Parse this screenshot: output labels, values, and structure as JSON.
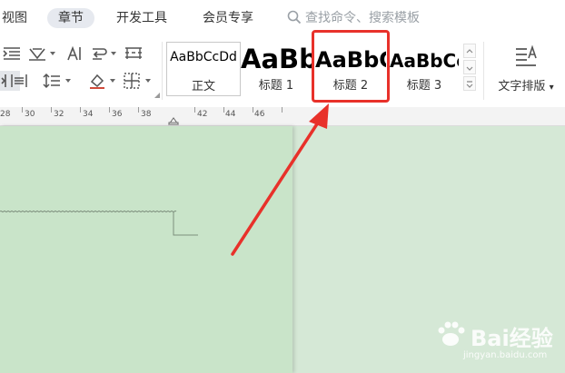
{
  "menubar": {
    "items": [
      "视图",
      "章节",
      "开发工具",
      "会员专享"
    ],
    "active": "章节",
    "search_placeholder": "查找命令、搜索模板"
  },
  "styles_gallery": {
    "cards": [
      {
        "sample": "AaBbCcDd",
        "name": "正文"
      },
      {
        "sample": "AaBb",
        "name": "标题 1"
      },
      {
        "sample": "AaBbC",
        "name": "标题 2"
      },
      {
        "sample": "AaBbCc",
        "name": "标题 3"
      }
    ],
    "highlighted": "标题 2"
  },
  "text_layout": {
    "label": "文字排版"
  },
  "ruler": {
    "labels": [
      "28",
      "30",
      "32",
      "34",
      "36",
      "38",
      "42",
      "44",
      "46"
    ]
  },
  "watermark": {
    "brand": "Bai经验",
    "url": "jingyan.baidu.com"
  },
  "colors": {
    "highlight": "#e8312a",
    "page": "#c9e4c9",
    "canvas": "#d5e8d6"
  }
}
